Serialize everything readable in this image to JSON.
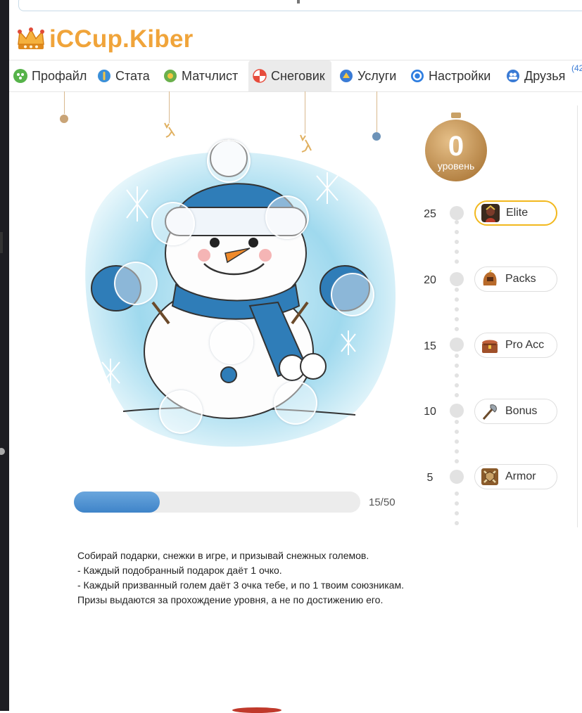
{
  "site": {
    "name": "iCCup.Kiber"
  },
  "nav": {
    "tabs": [
      {
        "label": "Профайл",
        "color": "#4caf50"
      },
      {
        "label": "Стата",
        "color": "#3a8fd8"
      },
      {
        "label": "Матчлист",
        "color": "#6ab04c"
      },
      {
        "label": "Снеговик",
        "color": "#e74c3c"
      },
      {
        "label": "Услуги",
        "color": "#3a7bd5"
      },
      {
        "label": "Настройки",
        "color": "#2f7ee0"
      },
      {
        "label": "Друзья",
        "color": "#3a7bd5"
      }
    ],
    "active_tab": "Снеговик",
    "friends_badge": "(42"
  },
  "snowman": {
    "progress_current": 15,
    "progress_max": 50,
    "progress_label": "15/50",
    "progress_fraction": 0.3
  },
  "level": {
    "value": "0",
    "word": "уровень"
  },
  "rewards": [
    {
      "level": "25",
      "label": "Elite",
      "highlighted": true,
      "icon": "elite-hero-icon"
    },
    {
      "level": "20",
      "label": "Packs",
      "highlighted": false,
      "icon": "packs-helmet-icon"
    },
    {
      "level": "15",
      "label": "Pro Acc",
      "highlighted": false,
      "icon": "pro-acc-chest-icon"
    },
    {
      "level": "10",
      "label": "Bonus",
      "highlighted": false,
      "icon": "bonus-axe-icon"
    },
    {
      "level": "5",
      "label": "Armor",
      "highlighted": false,
      "icon": "armor-icon"
    }
  ],
  "description": {
    "line1": "Собирай подарки, снежки в игре, и призывай снежных големов.",
    "line2": "- Каждый подобранный подарок даёт 1 очко.",
    "line3": "- Каждый призванный голем даёт 3 очка тебе, и по 1 твоим союзникам.",
    "line4": "Призы выдаются за прохождение уровня, а не по достижению его."
  }
}
